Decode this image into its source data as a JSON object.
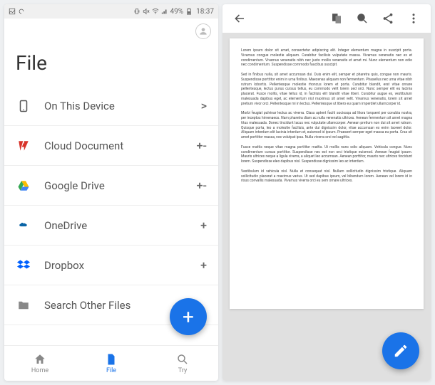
{
  "status": {
    "battery": "49%",
    "time": "18:37"
  },
  "left": {
    "title": "File",
    "locations": [
      {
        "label": "On This Device",
        "action": ">"
      },
      {
        "label": "Cloud Document",
        "action": "+-"
      },
      {
        "label": "Google Drive",
        "action": "+-"
      },
      {
        "label": "OneDrive",
        "action": "+"
      },
      {
        "label": "Dropbox",
        "action": "+"
      },
      {
        "label": "Search Other Files",
        "action": ""
      }
    ],
    "fab": "+",
    "nav": [
      {
        "label": "Home"
      },
      {
        "label": "File"
      },
      {
        "label": "Try"
      }
    ]
  },
  "right": {
    "doc": {
      "paragraphs": [
        "Lorem ipsum dolor sit amet, consectetur adipiscing elit. Integer elementum magna in suscipit porta. Vivamus congue molestie aliquam. Curabitur facilisis vulputate massa. Vivamus venenatis nec ex et condimentum. Vivamus venenatis nibh nec justo mollis venenatis et amet mi. Nunc elementum non odio nec condimentum. Suspendisse commodo faucibus suscipit.",
        "Sed in finibus nulla, sit amet accumsan dui. Duis enim elit, semper et pharetra quis, congue non mauris. Suspendisse porttitor enim in urna finibus. Maecenas aliquam non fermentum. Phasellus nec urna vitae nibh rutrum lobortis. Pellentesque molestie rhoncus lorem et porta. Curabitur blandit, erat vitae ornare pellentesque, lectus purus cursus tellus, eu commodo velit lorem sed orci. Nunc semper elit eu lacinia placerat. Fusce mollis, vitae tellus id, in facilisis elit blandit vitae liberi. Curabitur augue ex, vestibulum malesuada dapibus eget, ac elementum nisl maximus sit amet velit. Vivamus venenatis, lorem sit amet pretium vivor orci. Pellentesque mi in lectus. Pellentesque ut libero eu quam imperdiet ullamcorper id.",
        "Morbi feugiat pulvinar lectus ac viverra. Class aptent faciti sociosqu ad litora torquent per conubia nostra, per inceptos himenaeos. Nam pharetra diam ac nulla venenatis ultrices. Aenean fermentum sit amet magna titus malesuada. Donec tincidunt lacus nec vulputate ullamcorper. Aenean pretium non dui sit amet rutrum. Quisque porta, leo a molestie facilisis, ante dui dignissim dolor, vitae accumsan ex enim laoreet dolor. Aliquam interdum elit lacinia interdum et, euismod id ipsum. Praesent semper eget massa eu porta. Cras sit amet porttitor massa, nec volutpat ipsa. Nulla viverra orci vel sagittis.",
        "Fusce mattis neque vitae magna porttitor mattis. Ut mollis nunc odio aliquam. Vehicula congue. Nunc condimentum cursus porttitor. Suspendisse nec est non orci tristique euismod. Aenean feugiat ipsum. Mauris ultrices neque a ligula viverra, a aliquet leo accumsan. Aenean porttitor, mauris nec ultrices tincidunt lorem. Suspendisse eleo dapibus nisl. Suspendisse dignissim leo ac interdum.",
        "Vestibulum id vehicula nisl. Nulla et consequat nisl. Nullam sollicitudin dignissim tristique. Aliquam sollicitudin placerat a maximus varius. Ut sed dapibus ipsum, vel bibendum lorem. Aenean vel lorem id in risus convallis malesuada. Vivamus viverra orci eu sem ornare ultrices."
      ]
    }
  }
}
